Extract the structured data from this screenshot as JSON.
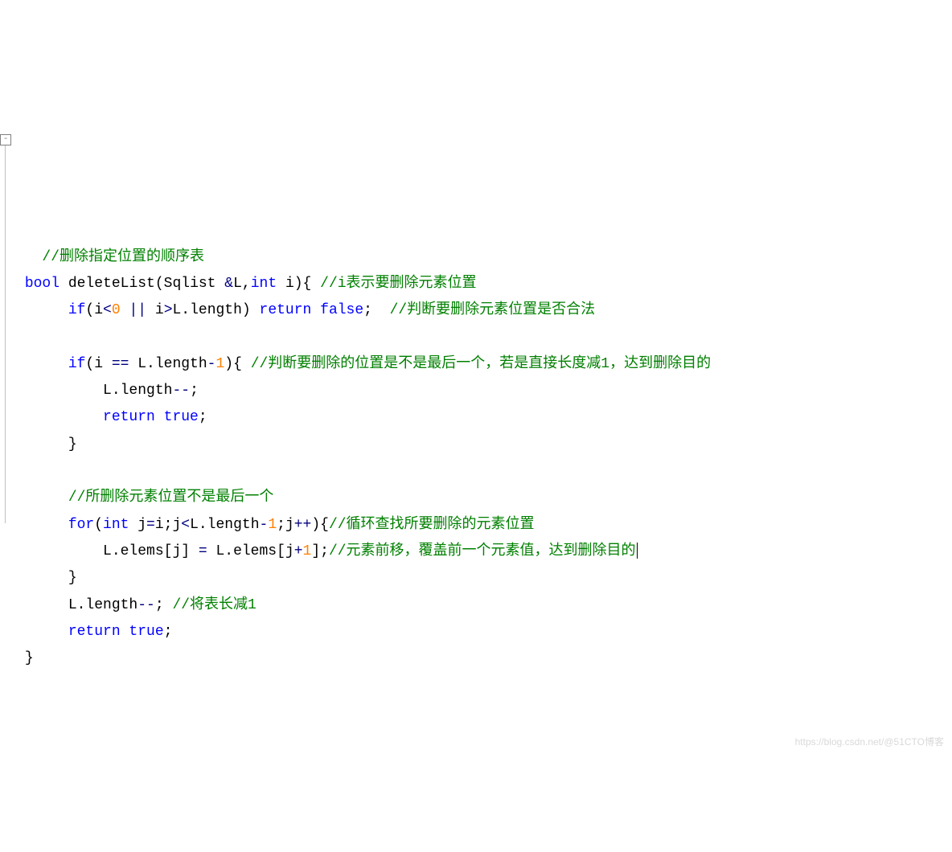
{
  "code": {
    "l1_comment": "//删除指定位置的顺序表",
    "l2_kw_bool": "bool",
    "l2_func": " deleteList",
    "l2_paren_open": "(",
    "l2_param1_type": "Sqlist ",
    "l2_param1_ref": "&",
    "l2_param1_name": "L",
    "l2_comma": ",",
    "l2_param2_type": "int",
    "l2_param2_name": " i",
    "l2_signature_close": "){ ",
    "l2_comment": "//i表示要删除元素位置",
    "l3_if": "if",
    "l3_cond": "(i<0 || i>L.length)",
    "l3_cond_open": "(i",
    "l3_lt": "<",
    "l3_zero": "0",
    "l3_oror": " || ",
    "l3_i2": "i",
    "l3_gt": ">",
    "l3_llen": "L.length) ",
    "l3_return": "return",
    "l3_false": " false",
    "l3_semi": ";  ",
    "l3_comment": "//判断要删除元素位置是否合法",
    "l5_if": "if",
    "l5_cond": "(i == L.length-1){ ",
    "l5_open": "(i ",
    "l5_eq": "==",
    "l5_llen": " L.length",
    "l5_minus": "-",
    "l5_one": "1",
    "l5_brace": "){ ",
    "l5_comment": "//判断要删除的位置是不是最后一个，若是直接长度减1，达到删除目的",
    "l6_stmt": "L.length--;",
    "l6_llen": "L.length",
    "l6_dec": "--",
    "l6_semi": ";",
    "l7_return": "return",
    "l7_true": " true",
    "l7_semi": ";",
    "l8_brace": "}",
    "l10_comment": "//所删除元素位置不是最后一个",
    "l11_for": "for",
    "l11_open": "(",
    "l11_int": "int",
    "l11_init": " j=i;j<L.length-1;j++){",
    "l11_jeq": " j",
    "l11_assign": "=",
    "l11_i": "i;j",
    "l11_lt": "<",
    "l11_llen": "L.length",
    "l11_minus": "-",
    "l11_one": "1",
    "l11_semi": ";j",
    "l11_inc": "++",
    "l11_close": "){",
    "l11_comment": "//循环查找所要删除的元素位置",
    "l12_lhs": "L.elems[j] ",
    "l12_eq": "=",
    "l12_rhs": " L.elems[j",
    "l12_plus": "+",
    "l12_one": "1",
    "l12_close": "];",
    "l12_comment": "//元素前移，覆盖前一个元素值，达到删除目的",
    "l13_brace": "}",
    "l14_stmt": "L.length",
    "l14_dec": "--",
    "l14_semi": "; ",
    "l14_comment": "//将表长减1",
    "l15_return": "return",
    "l15_true": " true",
    "l15_semi": ";",
    "l16_brace": "}"
  },
  "fold_marker": "-",
  "watermark": "https://blog.csdn.net/@51CTO博客"
}
